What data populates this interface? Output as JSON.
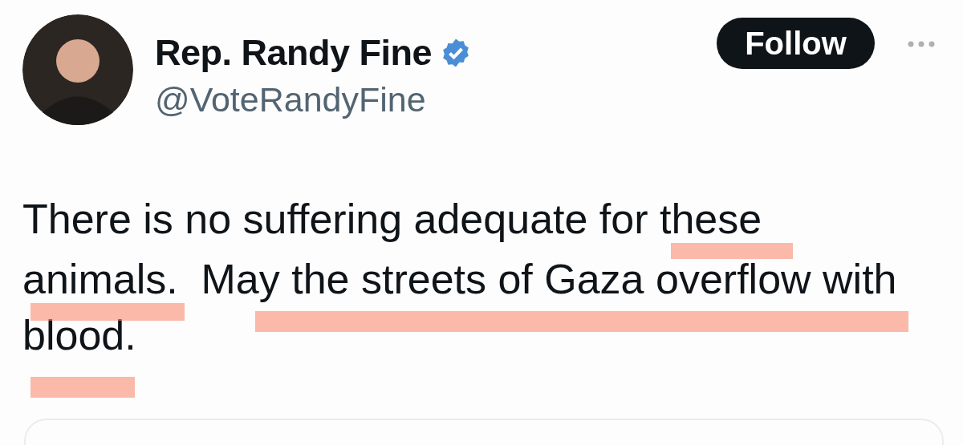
{
  "author": {
    "name": "Rep. Randy Fine",
    "verified": true,
    "handle": "@VoteRandyFine"
  },
  "follow_button": {
    "label": "Follow"
  },
  "tweet": {
    "lines": [
      "There is no suffering adequate for these",
      "animals.  May the streets of Gaza overflow with",
      "blood."
    ]
  }
}
